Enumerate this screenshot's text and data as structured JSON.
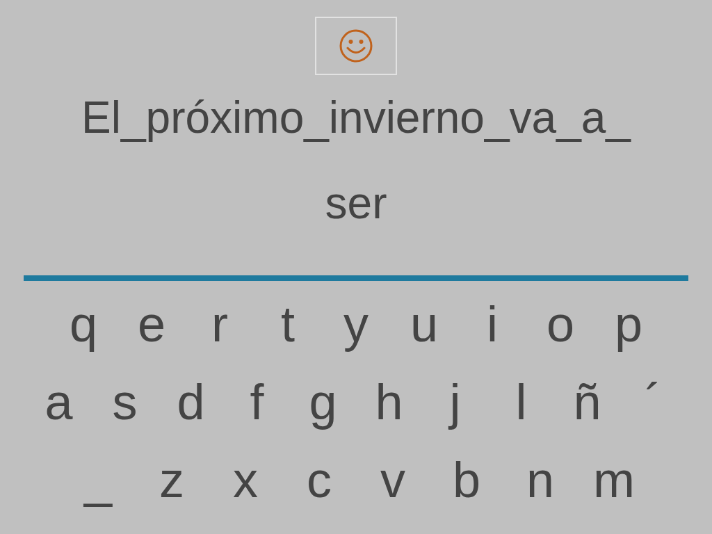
{
  "sentence_lines": [
    "El_próximo_invierno_va_a_",
    "ser"
  ],
  "keyboard_rows": [
    [
      "q",
      "e",
      "r",
      "t",
      "y",
      "u",
      "i",
      "o",
      "p"
    ],
    [
      "a",
      "s",
      "d",
      "f",
      "g",
      "h",
      "j",
      "l",
      "ñ",
      "´"
    ],
    [
      "_",
      "z",
      "x",
      "c",
      "v",
      "b",
      "n",
      "m"
    ]
  ]
}
